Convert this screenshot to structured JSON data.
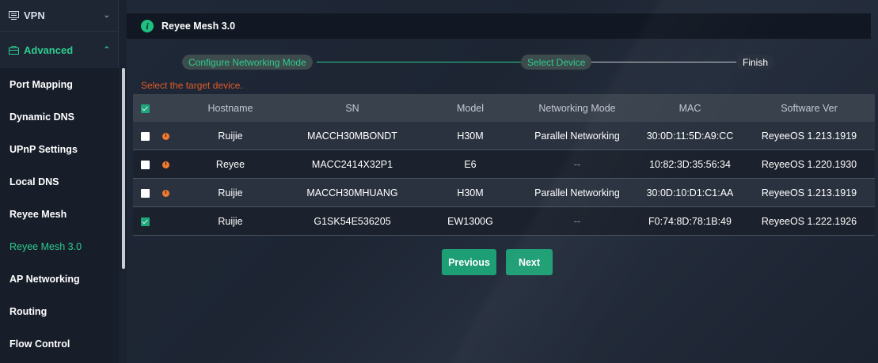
{
  "sidebar": {
    "vpn": {
      "label": "VPN",
      "icon": "vpn-icon"
    },
    "advanced": {
      "label": "Advanced",
      "icon": "briefcase-icon"
    },
    "items": [
      {
        "label": "Port Mapping"
      },
      {
        "label": "Dynamic DNS"
      },
      {
        "label": "UPnP Settings"
      },
      {
        "label": "Local DNS"
      },
      {
        "label": "Reyee Mesh"
      },
      {
        "label": "Reyee Mesh 3.0",
        "active": true
      },
      {
        "label": "AP Networking"
      },
      {
        "label": "Routing"
      },
      {
        "label": "Flow Control"
      }
    ]
  },
  "header": {
    "title": "Reyee Mesh 3.0"
  },
  "steps": {
    "step1": "Configure Networking Mode",
    "step2": "Select Device",
    "step3": "Finish"
  },
  "hint": "Select the target device.",
  "table": {
    "columns": [
      "Hostname",
      "SN",
      "Model",
      "Networking Mode",
      "MAC",
      "Software Ver"
    ],
    "rows": [
      {
        "hostname": "Ruijie",
        "sn": "MACCH30MBONDT",
        "model": "H30M",
        "mode": "Parallel Networking",
        "mac": "30:0D:11:5D:A9:CC",
        "ver": "ReyeeOS 1.213.1919",
        "checked": false,
        "warning": true
      },
      {
        "hostname": "Reyee",
        "sn": "MACC2414X32P1",
        "model": "E6",
        "mode": "--",
        "mac": "10:82:3D:35:56:34",
        "ver": "ReyeeOS 1.220.1930",
        "checked": false,
        "warning": true
      },
      {
        "hostname": "Ruijie",
        "sn": "MACCH30MHUANG",
        "model": "H30M",
        "mode": "Parallel Networking",
        "mac": "30:0D:10:D1:C1:AA",
        "ver": "ReyeeOS 1.213.1919",
        "checked": false,
        "warning": true
      },
      {
        "hostname": "Ruijie",
        "sn": "G1SK54E536205",
        "model": "EW1300G",
        "mode": "--",
        "mac": "F0:74:8D:78:1B:49",
        "ver": "ReyeeOS 1.222.1926",
        "checked": true,
        "warning": false
      }
    ]
  },
  "buttons": {
    "previous": "Previous",
    "next": "Next"
  },
  "colors": {
    "accent": "#1e9e74",
    "active_text": "#2ecc8f",
    "hint": "#e05a2a",
    "warning": "#f07a2f"
  }
}
